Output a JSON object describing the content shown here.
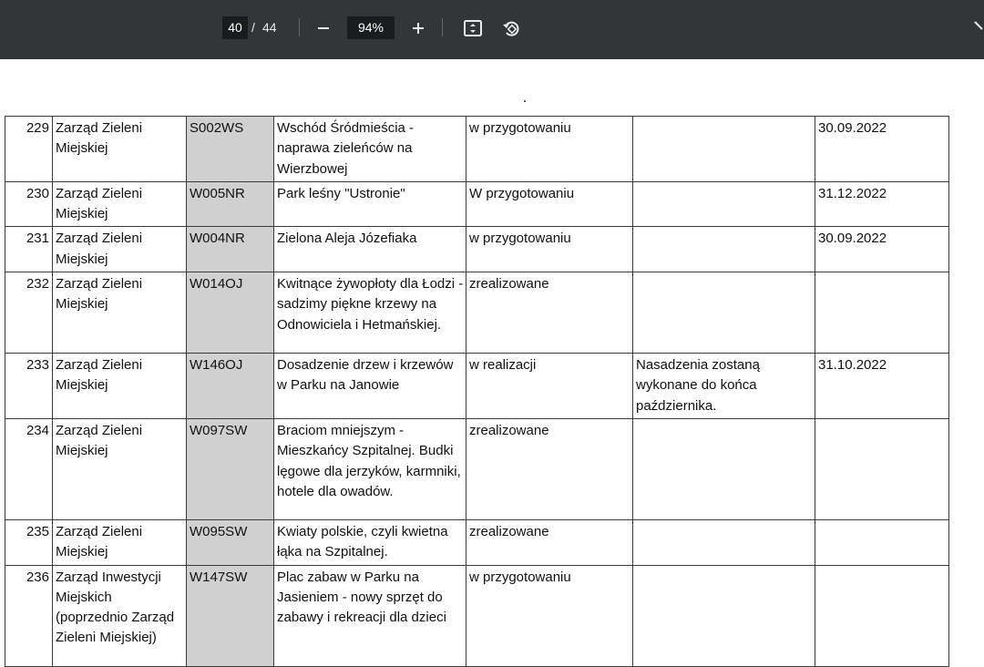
{
  "toolbar": {
    "current_page": "40",
    "page_separator": "/",
    "total_pages": "44",
    "zoom": "94%",
    "icons": [
      "minus-icon",
      "plus-icon",
      "fit-to-page-icon",
      "rotate-icon"
    ],
    "background_color": "#323639"
  },
  "table": {
    "rows": [
      {
        "num": "229",
        "org": "Zarząd Zieleni Miejskiej",
        "code": "S002WS",
        "title": "Wschód Śródmieścia - naprawa zieleńców na Wierzbowej",
        "status": "w przygotowaniu",
        "notes": "",
        "date": "30.09.2022"
      },
      {
        "num": "230",
        "org": "Zarząd Zieleni Miejskiej",
        "code": "W005NR",
        "title": "Park leśny \"Ustronie\"",
        "status": "W przygotowaniu",
        "notes": "",
        "date": "31.12.2022"
      },
      {
        "num": "231",
        "org": "Zarząd Zieleni Miejskiej",
        "code": "W004NR",
        "title": "Zielona Aleja Józefiaka",
        "status": "w przygotowaniu",
        "notes": "",
        "date": "30.09.2022"
      },
      {
        "num": "232",
        "org": "Zarząd Zieleni Miejskiej",
        "code": "W014OJ",
        "title": "Kwitnące żywopłoty dla Łodzi - sadzimy piękne krzewy na Odnowiciela i Hetmańskiej.",
        "status": "zrealizowane",
        "notes": "",
        "date": ""
      },
      {
        "num": "233",
        "org": "Zarząd Zieleni Miejskiej",
        "code": "W146OJ",
        "title": "Dosadzenie drzew i krzewów w Parku na Janowie",
        "status": "w realizacji",
        "notes": "Nasadzenia zostaną wykonane do końca października.",
        "date": "31.10.2022"
      },
      {
        "num": "234",
        "org": "Zarząd Zieleni Miejskiej",
        "code": "W097SW",
        "title": "Braciom mniejszym - Mieszkańcy Szpitalnej. Budki lęgowe dla jerzyków, karmniki, hotele dla owadów.",
        "status": "zrealizowane",
        "notes": "",
        "date": ""
      },
      {
        "num": "235",
        "org": "Zarząd Zieleni Miejskiej",
        "code": "W095SW",
        "title": "Kwiaty polskie, czyli kwietna łąka na Szpitalnej.",
        "status": "zrealizowane",
        "notes": "",
        "date": ""
      },
      {
        "num": "236",
        "org": "Zarząd Inwestycji Miejskich (poprzednio Zarząd Zieleni Miejskiej)",
        "code": "W147SW",
        "title": "Plac zabaw w Parku na Jasieniem - nowy sprzęt do zabawy i rekreacji dla dzieci",
        "status": "w przygotowaniu",
        "notes": "",
        "date": ""
      }
    ]
  }
}
